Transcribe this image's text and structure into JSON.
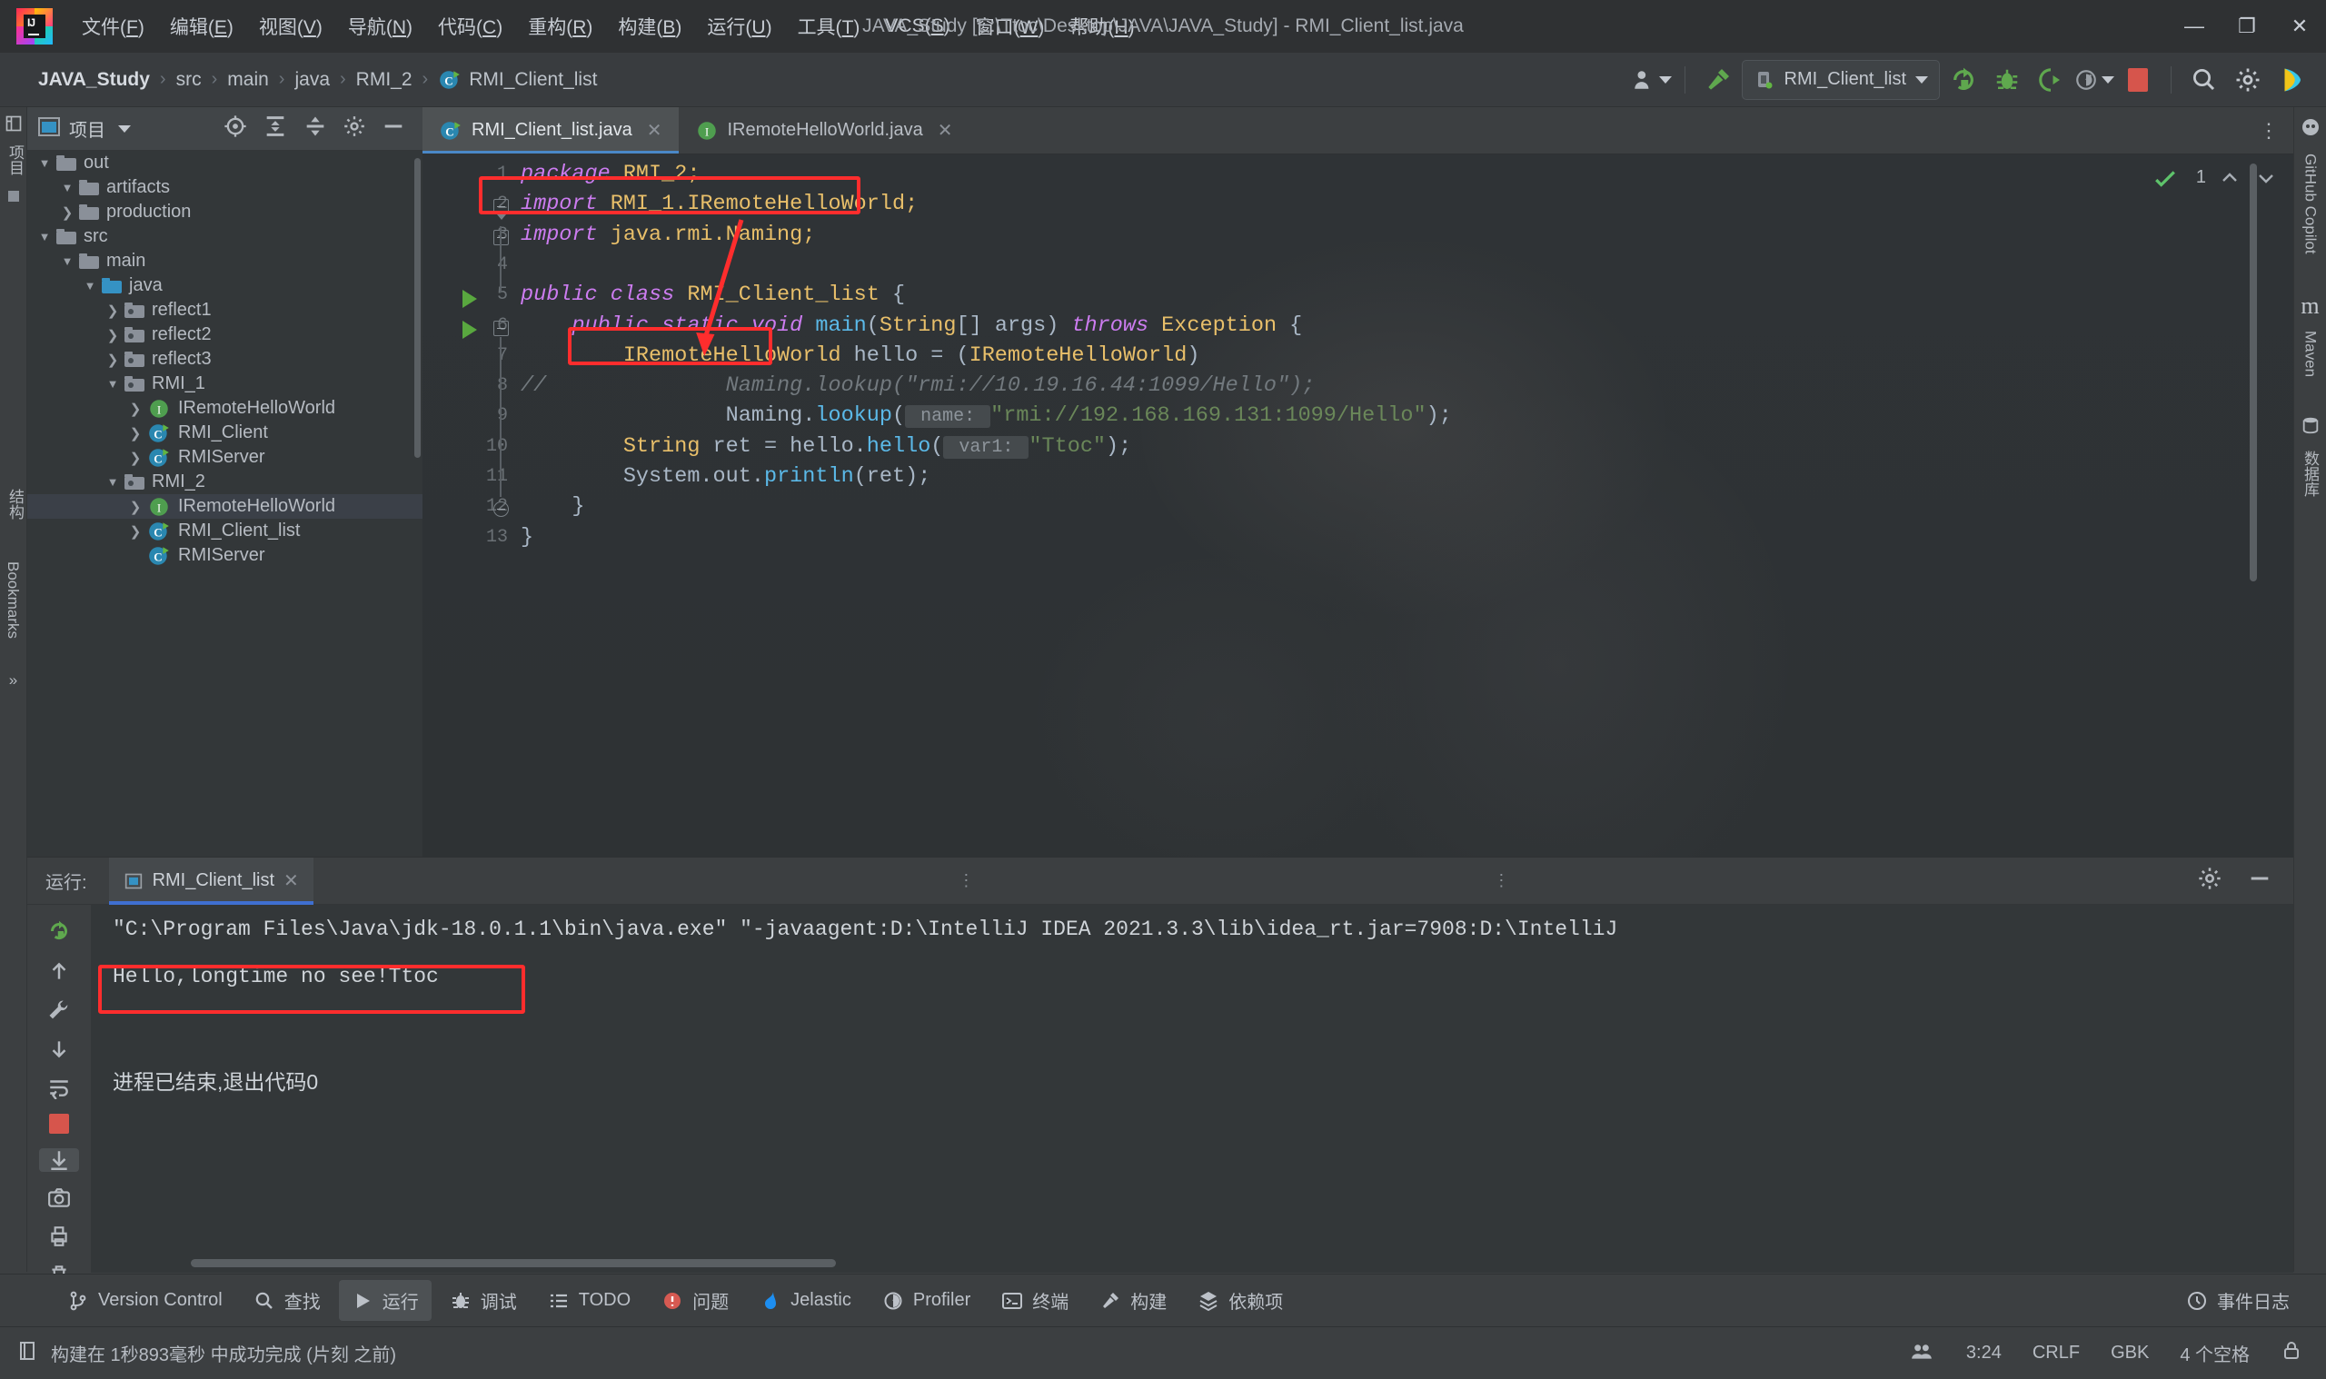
{
  "titlebar": {
    "window_title": "JAVA_Study [E:\\Ttoc\\Desktop\\JAVA\\JAVA_Study] - RMI_Client_list.java",
    "menus": [
      {
        "label": "文件(F)"
      },
      {
        "label": "编辑(E)"
      },
      {
        "label": "视图(V)"
      },
      {
        "label": "导航(N)"
      },
      {
        "label": "代码(C)"
      },
      {
        "label": "重构(R)"
      },
      {
        "label": "构建(B)"
      },
      {
        "label": "运行(U)"
      },
      {
        "label": "工具(T)"
      },
      {
        "label": "VCS(S)"
      },
      {
        "label": "窗口(W)"
      },
      {
        "label": "帮助(H)"
      }
    ],
    "minimize": "—",
    "maximize": "❐",
    "close": "✕"
  },
  "navbar": {
    "crumbs": [
      "JAVA_Study",
      "src",
      "main",
      "java",
      "RMI_2",
      "RMI_Client_list"
    ],
    "separator": "›",
    "run_config": "RMI_Client_list"
  },
  "left_stripe": {
    "items": [
      "项目",
      "结构",
      "Bookmarks"
    ],
    "more": "»"
  },
  "right_stripe": {
    "items": [
      "GitHub Copilot",
      "Maven",
      "数据库"
    ]
  },
  "project_panel": {
    "title": "项目",
    "tree": [
      {
        "label": "out",
        "depth": 1,
        "arrow": "down",
        "icon": "folder",
        "sel": false
      },
      {
        "label": "artifacts",
        "depth": 2,
        "arrow": "down",
        "icon": "folder",
        "sel": false
      },
      {
        "label": "production",
        "depth": 2,
        "arrow": "right",
        "icon": "folder",
        "sel": false
      },
      {
        "label": "src",
        "depth": 1,
        "arrow": "down",
        "icon": "folder",
        "sel": false
      },
      {
        "label": "main",
        "depth": 2,
        "arrow": "down",
        "icon": "folder",
        "sel": false
      },
      {
        "label": "java",
        "depth": 3,
        "arrow": "down",
        "icon": "folder-blue",
        "sel": false
      },
      {
        "label": "reflect1",
        "depth": 4,
        "arrow": "right",
        "icon": "package",
        "sel": false
      },
      {
        "label": "reflect2",
        "depth": 4,
        "arrow": "right",
        "icon": "package",
        "sel": false
      },
      {
        "label": "reflect3",
        "depth": 4,
        "arrow": "right",
        "icon": "package",
        "sel": false
      },
      {
        "label": "RMI_1",
        "depth": 4,
        "arrow": "down",
        "icon": "package",
        "sel": false
      },
      {
        "label": "IRemoteHelloWorld",
        "depth": 5,
        "arrow": "right",
        "icon": "interface",
        "sel": false
      },
      {
        "label": "RMI_Client",
        "depth": 5,
        "arrow": "right",
        "icon": "class",
        "sel": false
      },
      {
        "label": "RMIServer",
        "depth": 5,
        "arrow": "right",
        "icon": "class",
        "sel": false
      },
      {
        "label": "RMI_2",
        "depth": 4,
        "arrow": "down",
        "icon": "package",
        "sel": false
      },
      {
        "label": "IRemoteHelloWorld",
        "depth": 5,
        "arrow": "right",
        "icon": "interface",
        "sel": true
      },
      {
        "label": "RMI_Client_list",
        "depth": 5,
        "arrow": "right",
        "icon": "class",
        "sel": false
      },
      {
        "label": "RMIServer",
        "depth": 5,
        "arrow": "none",
        "icon": "class",
        "sel": false
      }
    ]
  },
  "editor": {
    "tabs": [
      {
        "label": "RMI_Client_list.java",
        "icon": "class",
        "active": true
      },
      {
        "label": "IRemoteHelloWorld.java",
        "icon": "interface",
        "active": false
      }
    ],
    "inspection_count": "1",
    "line_numbers": [
      "1",
      "2",
      "3",
      "4",
      "5",
      "6",
      "7",
      "8",
      "9",
      "10",
      "11",
      "12",
      "13"
    ],
    "code_lines": [
      {
        "n": 1,
        "segments": [
          {
            "t": "package ",
            "c": "kw"
          },
          {
            "t": "RMI_2;",
            "c": "cls2"
          }
        ]
      },
      {
        "n": 2,
        "segments": [
          {
            "t": "import ",
            "c": "kw"
          },
          {
            "t": "RMI_1.IRemoteHelloWorld;",
            "c": "cls2"
          }
        ]
      },
      {
        "n": 3,
        "segments": [
          {
            "t": "import ",
            "c": "kw"
          },
          {
            "t": "java.rmi.Naming;",
            "c": "cls2"
          }
        ]
      },
      {
        "n": 4,
        "segments": []
      },
      {
        "n": 5,
        "segments": [
          {
            "t": "public class ",
            "c": "kw"
          },
          {
            "t": "RMI_Client_list",
            "c": "cls2"
          },
          {
            "t": " {",
            "c": "plain"
          }
        ]
      },
      {
        "n": 6,
        "segments": [
          {
            "t": "    public static ",
            "c": "kw"
          },
          {
            "t": "void ",
            "c": "kw"
          },
          {
            "t": "main",
            "c": "fn"
          },
          {
            "t": "(",
            "c": "plain"
          },
          {
            "t": "String",
            "c": "cls2"
          },
          {
            "t": "[] args) ",
            "c": "plain"
          },
          {
            "t": "throws ",
            "c": "kw"
          },
          {
            "t": "Exception",
            "c": "cls2"
          },
          {
            "t": " {",
            "c": "plain"
          }
        ]
      },
      {
        "n": 7,
        "segments": [
          {
            "t": "        IRemoteHelloWorld",
            "c": "cls2"
          },
          {
            "t": " hello = (",
            "c": "plain"
          },
          {
            "t": "IRemoteHelloWorld",
            "c": "cls2"
          },
          {
            "t": ")",
            "c": "plain"
          }
        ]
      },
      {
        "n": 8,
        "segments": [
          {
            "t": "//              Naming.lookup(\"rmi://10.19.16.44:1099/Hello\");",
            "c": "cmt"
          }
        ]
      },
      {
        "n": 9,
        "segments": [
          {
            "t": "                Naming.",
            "c": "plain"
          },
          {
            "t": "lookup",
            "c": "fn"
          },
          {
            "t": "(",
            "c": "plain"
          },
          {
            "t": " name: ",
            "c": "hint"
          },
          {
            "t": "\"rmi://192.168.169.131:1099/Hello\"",
            "c": "str"
          },
          {
            "t": ");",
            "c": "plain"
          }
        ]
      },
      {
        "n": 10,
        "segments": [
          {
            "t": "        String",
            "c": "cls2"
          },
          {
            "t": " ret = hello.",
            "c": "plain"
          },
          {
            "t": "hello",
            "c": "fn"
          },
          {
            "t": "(",
            "c": "plain"
          },
          {
            "t": " var1: ",
            "c": "hint"
          },
          {
            "t": "\"Ttoc\"",
            "c": "str"
          },
          {
            "t": ");",
            "c": "plain"
          }
        ]
      },
      {
        "n": 11,
        "segments": [
          {
            "t": "        System.",
            "c": "plain"
          },
          {
            "t": "out",
            "c": "id"
          },
          {
            "t": ".",
            "c": "plain"
          },
          {
            "t": "println",
            "c": "fn"
          },
          {
            "t": "(ret);",
            "c": "plain"
          }
        ]
      },
      {
        "n": 12,
        "segments": [
          {
            "t": "    }",
            "c": "plain"
          }
        ]
      },
      {
        "n": 13,
        "segments": [
          {
            "t": "}",
            "c": "plain"
          }
        ]
      }
    ],
    "annotation_color": "#ff2d2d"
  },
  "run_panel": {
    "label": "运行:",
    "tab": "RMI_Client_list",
    "console_lines": [
      "\"C:\\Program Files\\Java\\jdk-18.0.1.1\\bin\\java.exe\" \"-javaagent:D:\\IntelliJ IDEA 2021.3.3\\lib\\idea_rt.jar=7908:D:\\IntelliJ ",
      "Hello,longtime no see!Ttoc",
      "",
      "进程已结束,退出代码0"
    ],
    "highlighted_line_index": 1
  },
  "tool_strip": {
    "items": [
      {
        "label": "Version Control",
        "icon": "branch-icon",
        "active": false
      },
      {
        "label": "查找",
        "icon": "search-icon",
        "active": false
      },
      {
        "label": "运行",
        "icon": "run-icon",
        "active": true
      },
      {
        "label": "调试",
        "icon": "bug-icon",
        "active": false
      },
      {
        "label": "TODO",
        "icon": "todo-icon",
        "active": false
      },
      {
        "label": "问题",
        "icon": "problems-icon",
        "active": false
      },
      {
        "label": "Jelastic",
        "icon": "jelastic-icon",
        "active": false
      },
      {
        "label": "Profiler",
        "icon": "profiler-icon",
        "active": false
      },
      {
        "label": "终端",
        "icon": "terminal-icon",
        "active": false
      },
      {
        "label": "构建",
        "icon": "build-icon",
        "active": false
      },
      {
        "label": "依赖项",
        "icon": "deps-icon",
        "active": false
      }
    ],
    "right_item": {
      "label": "事件日志",
      "icon": "event-log-icon"
    }
  },
  "statusbar": {
    "message": "构建在 1秒893毫秒 中成功完成 (片刻 之前)",
    "caret": "3:24",
    "line_sep": "CRLF",
    "encoding": "GBK",
    "indent": "4 个空格"
  }
}
